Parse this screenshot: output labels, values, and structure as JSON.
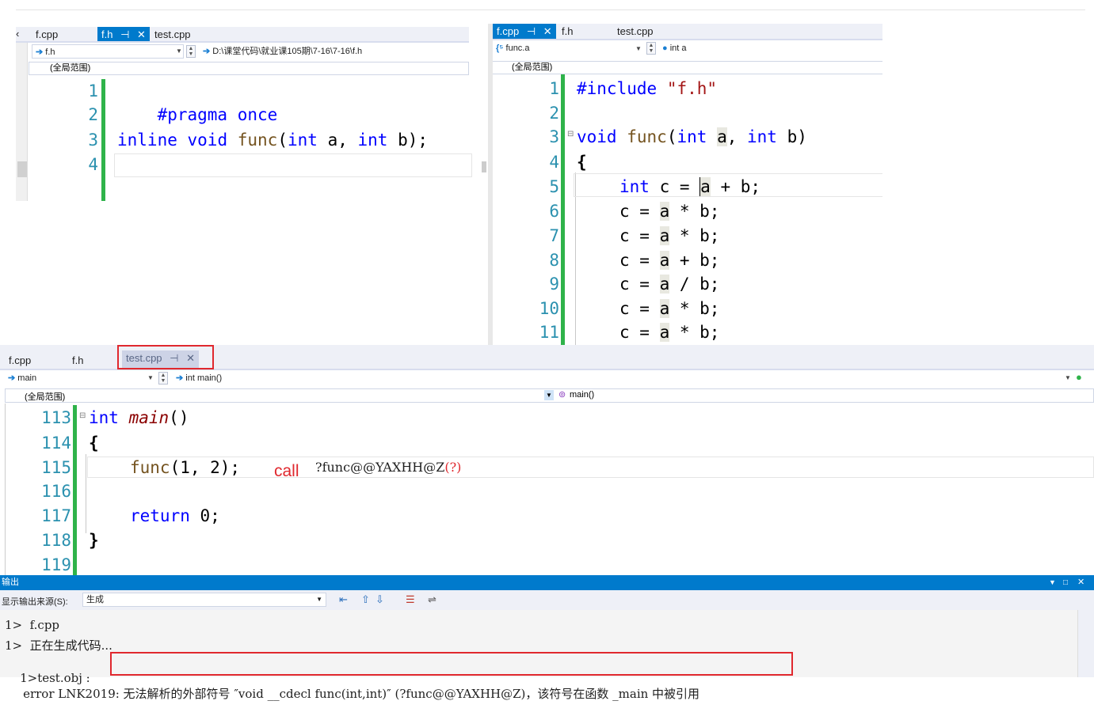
{
  "panel_fh": {
    "tabs": [
      "f.cpp",
      "f.h",
      "test.cpp"
    ],
    "tab_pin": "⊣",
    "tab_close": "✕",
    "nav_left": "f.h",
    "nav_path": "D:\\课堂代码\\就业课105期\\7-16\\7-16\\f.h",
    "scope": "(全局范围)",
    "line_numbers": [
      "1",
      "2",
      "3",
      "4"
    ],
    "code": {
      "l1_pp": "#pragma once",
      "l3_kw1": "inline",
      "l3_kw2": "void",
      "l3_fn": "func",
      "l3_p1": "(",
      "l3_kw3": "int",
      "l3_a": " a, ",
      "l3_kw4": "int",
      "l3_b": " b);"
    }
  },
  "panel_fcpp": {
    "tabs": [
      "f.cpp",
      "f.h",
      "test.cpp"
    ],
    "tab_pin": "⊣",
    "tab_close": "✕",
    "nav_left": "func.a",
    "nav_right": "int a",
    "scope": "(全局范围)",
    "line_numbers": [
      "1",
      "2",
      "3",
      "4",
      "5",
      "6",
      "7",
      "8",
      "9",
      "10",
      "11"
    ],
    "code": {
      "include_kw": "#include",
      "include_str": "\"f.h\"",
      "sig_kw1": "void",
      "sig_fn": "func",
      "sig_p": "(",
      "sig_kw2": "int",
      "sig_a": "a",
      "sig_comma": ", ",
      "sig_kw3": "int",
      "sig_b": " b)",
      "brace": "{",
      "l5_kw": "int",
      "l5_rest1": " c = ",
      "l5_a": "a",
      "l5_rest2": " + b;",
      "l6_pre": "c = ",
      "l6_a": "a",
      "l6_post": " * b;",
      "l7_pre": "c = ",
      "l7_a": "a",
      "l7_post": " * b;",
      "l8_pre": "c = ",
      "l8_a": "a",
      "l8_post": " + b;",
      "l9_pre": "c = ",
      "l9_a": "a",
      "l9_post": " / b;",
      "l10_pre": "c = ",
      "l10_a": "a",
      "l10_post": " * b;",
      "l11_pre": "c = ",
      "l11_a": "a",
      "l11_post": " * b;"
    }
  },
  "panel_test": {
    "tabs": [
      "f.cpp",
      "f.h",
      "test.cpp"
    ],
    "tab_pin": "⊣",
    "tab_close": "✕",
    "nav_left": "main",
    "nav_right": "int main()",
    "scope": "(全局范围)",
    "scope_right": "main()",
    "line_numbers": [
      "113",
      "114",
      "115",
      "116",
      "117",
      "118",
      "119"
    ],
    "code": {
      "main_kw": "int",
      "main_fn": "main",
      "main_paren": "()",
      "brace_open": "{",
      "call_fn": "func",
      "call_args": "(1, 2);",
      "ret_kw": "return",
      "ret_val": " 0;",
      "brace_close": "}"
    },
    "annotation": {
      "call_label": "call",
      "symbol": "?func@@YAXHH@Z",
      "question": "(?)"
    }
  },
  "output": {
    "title": "输出",
    "source_label": "显示输出来源(S):",
    "source_value": "生成",
    "lines": [
      "1>  f.cpp",
      "1>  正在生成代码...",
      "1>test.obj :"
    ],
    "error_text": "error LNK2019: 无法解析的外部符号 ″void __cdecl func(int,int)″ (?func@@YAXHH@Z)",
    "error_tail": "，该符号在函数 _main 中被引用"
  }
}
